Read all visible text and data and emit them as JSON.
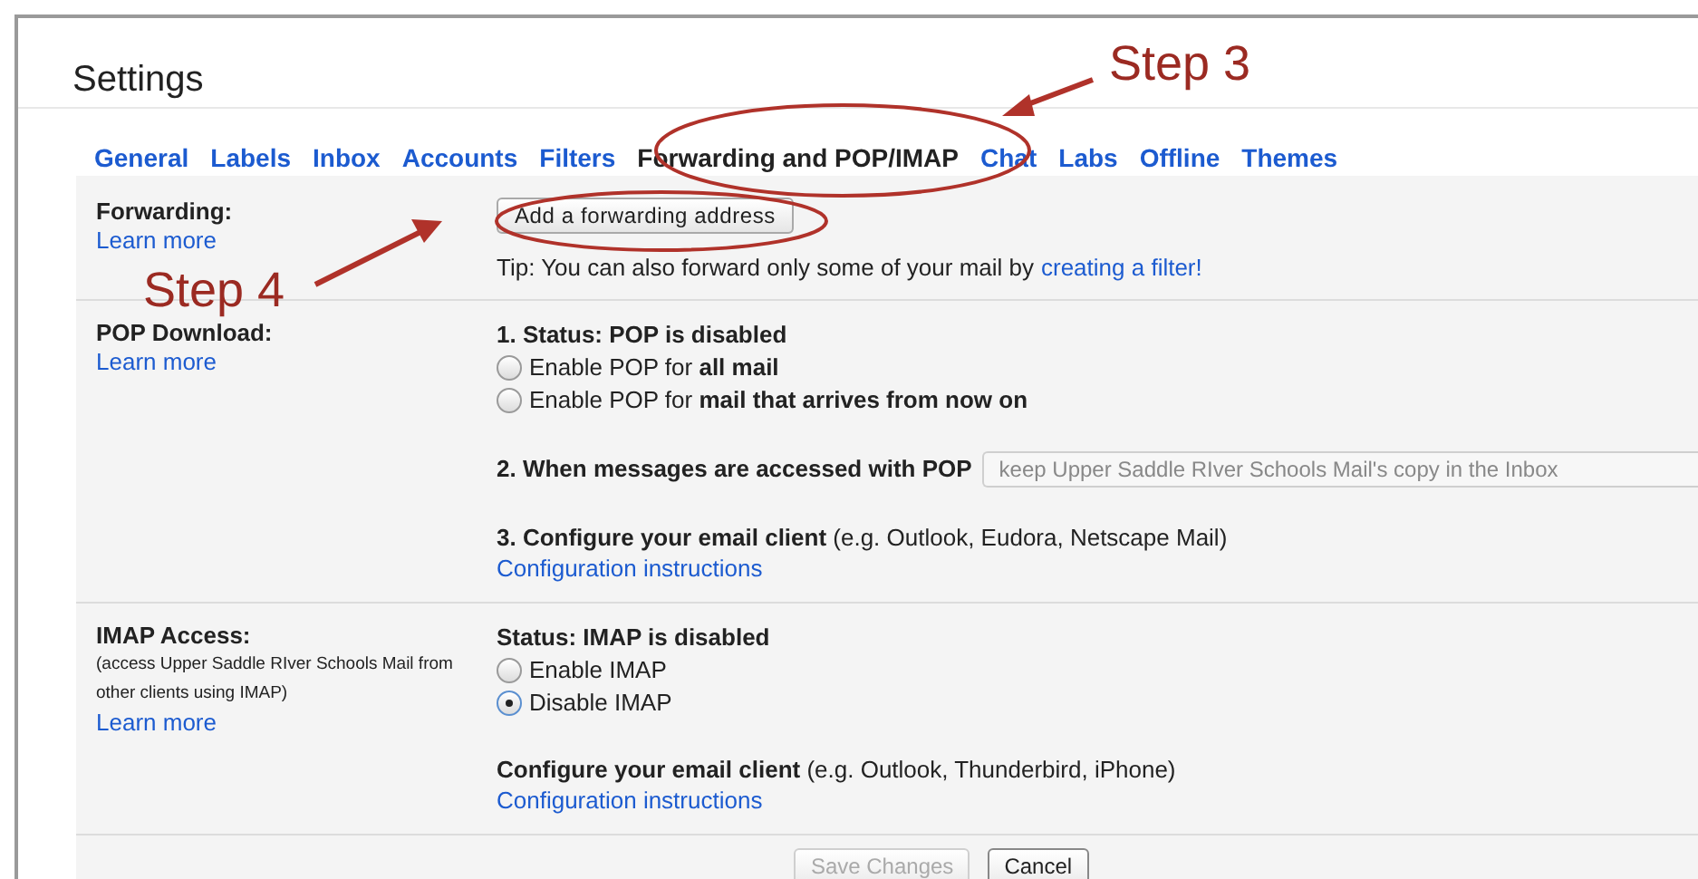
{
  "title": "Settings",
  "tabs": [
    {
      "label": "General",
      "selected": false
    },
    {
      "label": "Labels",
      "selected": false
    },
    {
      "label": "Inbox",
      "selected": false
    },
    {
      "label": "Accounts",
      "selected": false
    },
    {
      "label": "Filters",
      "selected": false
    },
    {
      "label": "Forwarding and POP/IMAP",
      "selected": true
    },
    {
      "label": "Chat",
      "selected": false
    },
    {
      "label": "Labs",
      "selected": false
    },
    {
      "label": "Offline",
      "selected": false
    },
    {
      "label": "Themes",
      "selected": false
    }
  ],
  "sections": [
    {
      "label": "Forwarding:",
      "learn_more": "Learn more",
      "groups": [
        [
          {
            "kind": "button",
            "text": "Add a forwarding address"
          }
        ],
        [
          {
            "kind": "tip",
            "text": "Tip: You can also forward only some of your mail by",
            "link": "creating a filter!"
          }
        ]
      ]
    },
    {
      "label": "POP Download:",
      "learn_more": "Learn more",
      "groups": [
        [
          {
            "kind": "heading",
            "text": "1. Status: POP is disabled"
          },
          {
            "kind": "radio",
            "text": "Enable POP for **all mail**",
            "selected": false
          },
          {
            "kind": "radio",
            "text": "Enable POP for **mail that arrives from now on**",
            "selected": false
          }
        ],
        [
          {
            "kind": "select",
            "text": "2. When messages are accessed with POP",
            "value": "keep Upper Saddle RIver Schools Mail's copy in the Inbox"
          }
        ],
        [
          {
            "kind": "heading",
            "text": "**3. Configure your email client** (e.g. Outlook, Eudora, Netscape Mail)"
          },
          {
            "kind": "link",
            "text": "Configuration instructions"
          }
        ]
      ]
    },
    {
      "label": "IMAP Access:",
      "note": "(access Upper Saddle RIver Schools Mail from other clients using IMAP)",
      "learn_more": "Learn more",
      "groups": [
        [
          {
            "kind": "heading",
            "text": "Status: IMAP is disabled"
          },
          {
            "kind": "radio",
            "text": "Enable IMAP",
            "selected": false
          },
          {
            "kind": "radio",
            "text": "Disable IMAP",
            "selected": true
          }
        ],
        [
          {
            "kind": "heading",
            "text": "**Configure your email client** (e.g. Outlook, Thunderbird, iPhone)"
          },
          {
            "kind": "link",
            "text": "Configuration instructions"
          }
        ]
      ]
    }
  ],
  "footer_buttons": [
    {
      "label": "Save Changes",
      "disabled": true
    },
    {
      "label": "Cancel",
      "disabled": false
    }
  ],
  "annotations": [
    {
      "label": "Step 3"
    },
    {
      "label": "Step 4"
    }
  ]
}
